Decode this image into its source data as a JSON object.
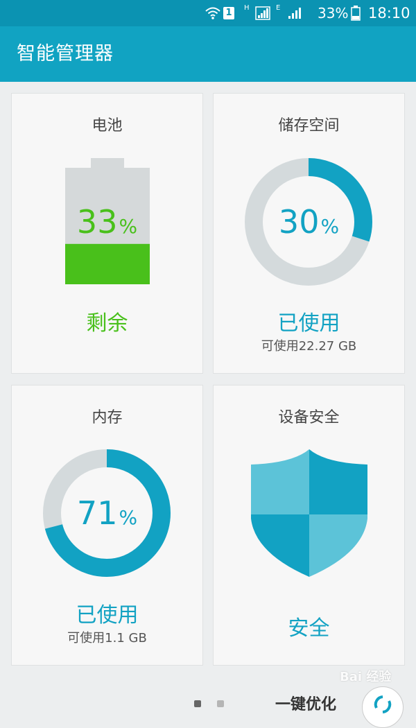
{
  "status_bar": {
    "sim_label": "1",
    "net_h": "H",
    "net_e": "E",
    "battery": "33%",
    "time": "18:10"
  },
  "app_bar": {
    "title": "智能管理器"
  },
  "cards": {
    "battery": {
      "title": "电池",
      "percent": 33,
      "percent_text": "33",
      "unit": "%",
      "status": "剩余",
      "accent": "#49c01b"
    },
    "storage": {
      "title": "储存空间",
      "percent": 30,
      "percent_text": "30",
      "unit": "%",
      "status": "已使用",
      "available": "可使用22.27 GB",
      "accent": "#12a2c3"
    },
    "memory": {
      "title": "内存",
      "percent": 71,
      "percent_text": "71",
      "unit": "%",
      "status": "已使用",
      "available": "可使用1.1 GB",
      "accent": "#12a2c3"
    },
    "security": {
      "title": "设备安全",
      "status": "安全",
      "icon": "shield-icon",
      "accent": "#12a2c3"
    }
  },
  "bottom": {
    "action_label": "一键优化"
  },
  "watermark": {
    "text": "Bai 经验"
  },
  "colors": {
    "accent": "#12a2c3",
    "battery_green": "#49c01b",
    "ring_track": "#d4dadc"
  }
}
